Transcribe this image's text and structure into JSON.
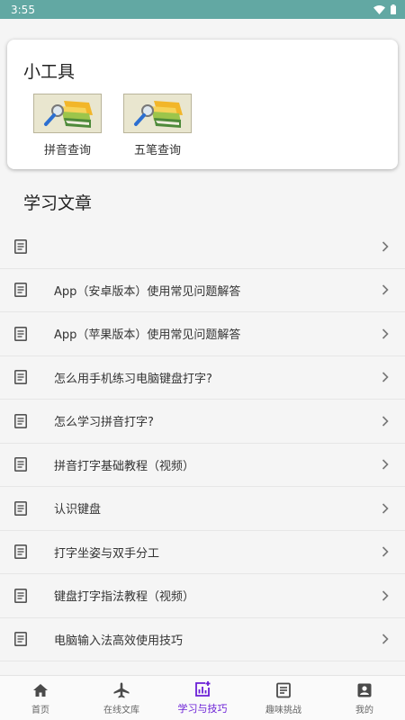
{
  "status": {
    "time": "3:55"
  },
  "tools": {
    "title": "小工具",
    "items": [
      {
        "label": "拼音查询",
        "icon": "books-magnifier-icon"
      },
      {
        "label": "五笔查询",
        "icon": "books-magnifier-icon"
      }
    ]
  },
  "articles": {
    "title": "学习文章",
    "items": [
      {
        "label": ""
      },
      {
        "label": "App（安卓版本）使用常见问题解答"
      },
      {
        "label": "App（苹果版本）使用常见问题解答"
      },
      {
        "label": "怎么用手机练习电脑键盘打字?"
      },
      {
        "label": "怎么学习拼音打字?"
      },
      {
        "label": "拼音打字基础教程（视频）"
      },
      {
        "label": "认识键盘"
      },
      {
        "label": "打字坐姿与双手分工"
      },
      {
        "label": "键盘打字指法教程（视频）"
      },
      {
        "label": "电脑输入法高效使用技巧"
      }
    ]
  },
  "tabs": [
    {
      "label": "首页",
      "icon": "home-icon",
      "active": false
    },
    {
      "label": "在线文库",
      "icon": "airplane-icon",
      "active": false
    },
    {
      "label": "学习与技巧",
      "icon": "stats-add-icon",
      "active": true
    },
    {
      "label": "趣味挑战",
      "icon": "article-icon",
      "active": false
    },
    {
      "label": "我的",
      "icon": "profile-icon",
      "active": false
    }
  ],
  "colors": {
    "status_bar": "#62a8a3",
    "accent": "#6a1fd6"
  }
}
